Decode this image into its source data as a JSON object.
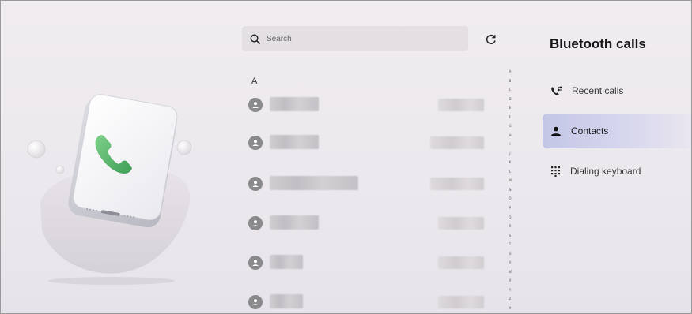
{
  "search": {
    "placeholder": "Search",
    "icon": "search-icon"
  },
  "refresh": {
    "icon": "refresh-icon"
  },
  "contacts": {
    "section_letter": "A",
    "rows": [
      {
        "name": "",
        "number": ""
      },
      {
        "name": "",
        "number": ""
      },
      {
        "name": "",
        "number": ""
      },
      {
        "name": "",
        "number": ""
      },
      {
        "name": "",
        "number": ""
      },
      {
        "name": "",
        "number": ""
      }
    ]
  },
  "alphabet_index": [
    "A",
    "B",
    "C",
    "D",
    "E",
    "F",
    "G",
    "H",
    "I",
    "J",
    "K",
    "L",
    "M",
    "N",
    "O",
    "P",
    "Q",
    "R",
    "S",
    "T",
    "U",
    "V",
    "W",
    "X",
    "Y",
    "Z",
    "#"
  ],
  "nav": {
    "title": "Bluetooth calls",
    "items": [
      {
        "label": "Recent calls",
        "icon": "recent-calls-icon",
        "active": false
      },
      {
        "label": "Contacts",
        "icon": "contacts-icon",
        "active": true
      },
      {
        "label": "Dialing keyboard",
        "icon": "dialpad-icon",
        "active": false
      }
    ]
  },
  "colors": {
    "accent": "#c3c6e6",
    "phone_green": "#5bb86a",
    "avatar": "#8a898c"
  }
}
